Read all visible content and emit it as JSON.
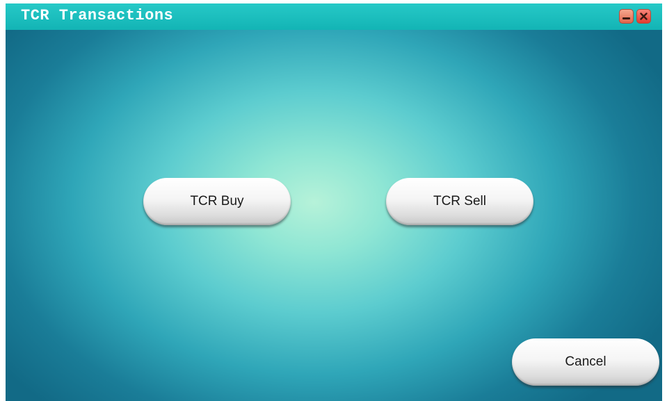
{
  "window": {
    "title": "TCR Transactions",
    "minimize_label": "Minimize",
    "close_label": "Close"
  },
  "actions": {
    "buy_label": "TCR Buy",
    "sell_label": "TCR Sell",
    "cancel_label": "Cancel"
  },
  "icons": {
    "minimize": "minimize-icon",
    "close": "close-icon"
  },
  "colors": {
    "titlebar": "#1bbfbe",
    "background_center": "#b6f2d9",
    "background_edge": "#126a86",
    "window_control": "#e9644f"
  }
}
